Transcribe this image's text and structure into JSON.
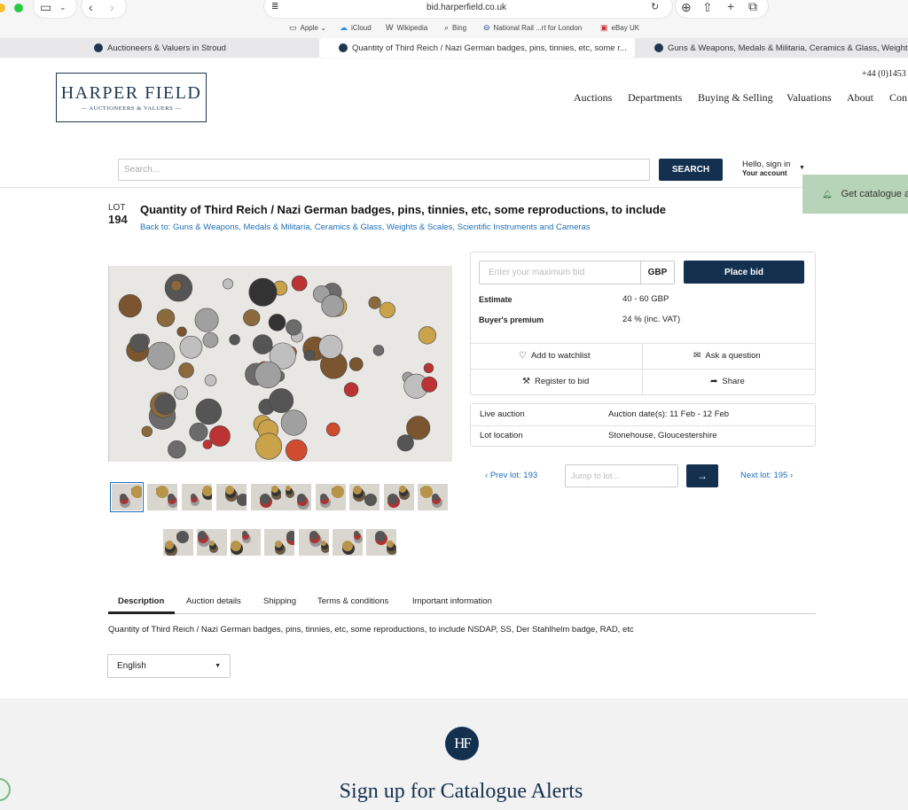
{
  "browser": {
    "url": "bid.harperfield.co.uk",
    "bookmarks": [
      "Apple",
      "iCloud",
      "Wikipedia",
      "Bing",
      "National Rail ...rt for London",
      "eBay UK"
    ],
    "tabs": [
      "Auctioneers & Valuers in Stroud",
      "Quantity of Third Reich / Nazi German badges, pins, tinnies, etc, some r...",
      "Guns & Weapons, Medals & Militaria, Ceramics & Glass, Weights"
    ]
  },
  "header": {
    "logo_line1": "HARPER FIELD",
    "logo_line2": "AUCTIONEERS & VALUERS",
    "phone": "+44 (0)1453",
    "nav": [
      "Auctions",
      "Departments",
      "Buying & Selling",
      "Valuations",
      "About",
      "Con"
    ]
  },
  "search": {
    "placeholder": "Search...",
    "button": "SEARCH"
  },
  "account": {
    "greeting": "Hello, sign in",
    "label": "Your account"
  },
  "catalogue_banner": "Get catalogue a",
  "lot": {
    "label": "LOT",
    "number": "194",
    "title": "Quantity of Third Reich / Nazi German badges, pins, tinnies, etc, some reproductions, to include",
    "back_link": "Back to: Guns & Weapons, Medals & Militaria, Ceramics & Glass, Weights & Scales, Scientific Instruments and Cameras"
  },
  "bid": {
    "placeholder": "Enter your maximum bid",
    "currency": "GBP",
    "place_bid": "Place bid",
    "estimate_label": "Estimate",
    "estimate_value": "40 - 60 GBP",
    "premium_label": "Buyer's premium",
    "premium_value": "24 % (inc. VAT)",
    "actions": [
      "Add to watchlist",
      "Ask a question",
      "Register to bid",
      "Share"
    ]
  },
  "auction_info": {
    "type": "Live auction",
    "dates": "Auction date(s): 11 Feb - 12 Feb",
    "location_label": "Lot location",
    "location_value": "Stonehouse, Gloucestershire"
  },
  "lot_nav": {
    "prev": "Prev lot: 193",
    "jump_placeholder": "Jump to lot...",
    "next": "Next lot: 195"
  },
  "detail_tabs": [
    "Description",
    "Auction details",
    "Shipping",
    "Terms & conditions",
    "Important information"
  ],
  "description": "Quantity of Third Reich / Nazi German badges, pins, tinnies, etc, some reproductions, to include NSDAP, SS, Der Stahlhelm badge, RAD, etc",
  "language": "English",
  "footer": {
    "logo_text": "HF",
    "signup": "Sign up for Catalogue Alerts"
  },
  "colors": {
    "navy": "#14304f",
    "link": "#1f6fb8",
    "banner_green": "#b8d4b8"
  }
}
